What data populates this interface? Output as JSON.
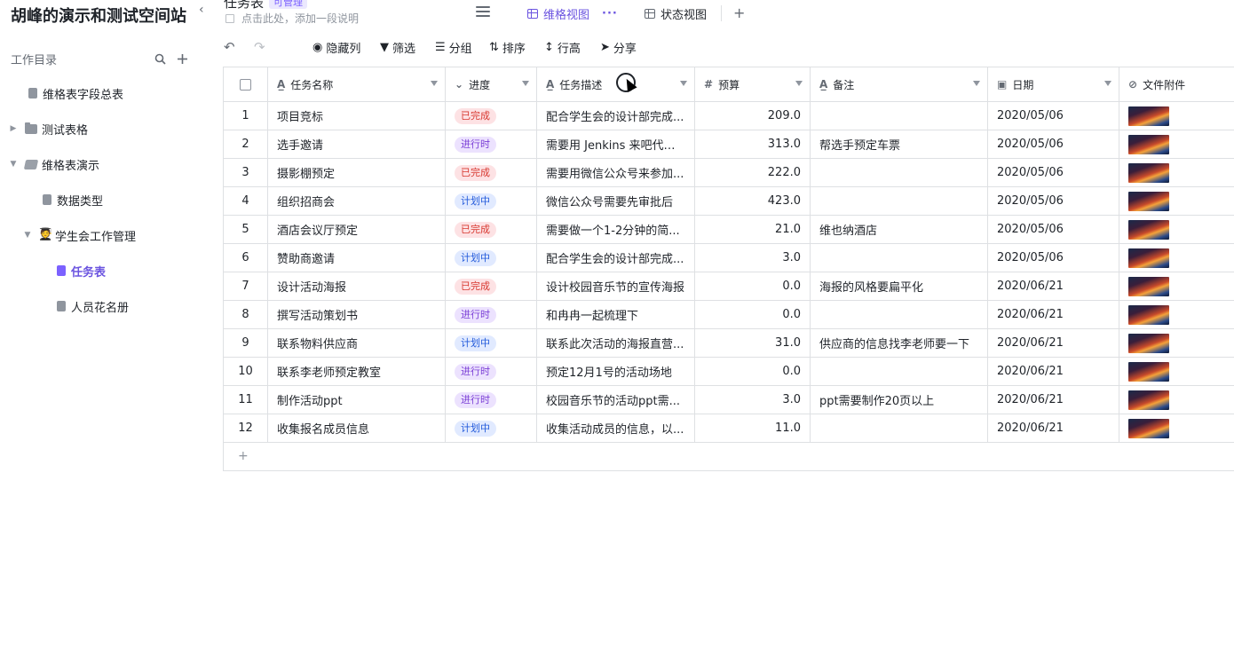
{
  "sidebar": {
    "space_title": "胡峰的演示和测试空间站",
    "workdir_label": "工作目录",
    "items": [
      {
        "label": "维格表字段总表"
      },
      {
        "label": "测试表格"
      },
      {
        "label": "维格表演示"
      },
      {
        "label": "数据类型"
      },
      {
        "label": "学生会工作管理"
      },
      {
        "label": "任务表"
      },
      {
        "label": "人员花名册"
      }
    ]
  },
  "header": {
    "title": "任务表",
    "permission": "可管理",
    "description_placeholder": "点击此处，添加一段说明",
    "tabs": [
      {
        "label": "维格视图"
      },
      {
        "label": "状态视图"
      }
    ],
    "tab_more": "···"
  },
  "toolbar": {
    "hide_columns": "隐藏列",
    "filter": "筛选",
    "group": "分组",
    "sort": "排序",
    "row_height": "行高",
    "share": "分享"
  },
  "table": {
    "columns": [
      "任务名称",
      "进度",
      "任务描述",
      "预算",
      "备注",
      "日期",
      "文件附件"
    ],
    "rows": [
      {
        "num": "1",
        "name": "项目竞标",
        "status": "已完成",
        "desc": "配合学生会的设计部完成...",
        "budget": "209.0",
        "note": "",
        "date": "2020/05/06"
      },
      {
        "num": "2",
        "name": "选手邀请",
        "status": "进行时",
        "desc": "需要用 Jenkins 来吧代码...",
        "budget": "313.0",
        "note": "帮选手预定车票",
        "date": "2020/05/06"
      },
      {
        "num": "3",
        "name": "摄影棚预定",
        "status": "已完成",
        "desc": "需要用微信公众号来参加...",
        "budget": "222.0",
        "note": "",
        "date": "2020/05/06"
      },
      {
        "num": "4",
        "name": "组织招商会",
        "status": "计划中",
        "desc": "微信公众号需要先审批后",
        "budget": "423.0",
        "note": "",
        "date": "2020/05/06"
      },
      {
        "num": "5",
        "name": "酒店会议厅预定",
        "status": "已完成",
        "desc": "需要做一个1-2分钟的简...",
        "budget": "21.0",
        "note": "维也纳酒店",
        "date": "2020/05/06"
      },
      {
        "num": "6",
        "name": "赞助商邀请",
        "status": "计划中",
        "desc": "配合学生会的设计部完成...",
        "budget": "3.0",
        "note": "",
        "date": "2020/05/06"
      },
      {
        "num": "7",
        "name": "设计活动海报",
        "status": "已完成",
        "desc": "设计校园音乐节的宣传海报",
        "budget": "0.0",
        "note": "海报的风格要扁平化",
        "date": "2020/06/21"
      },
      {
        "num": "8",
        "name": "撰写活动策划书",
        "status": "进行时",
        "desc": "和冉冉一起梳理下",
        "budget": "0.0",
        "note": "",
        "date": "2020/06/21"
      },
      {
        "num": "9",
        "name": "联系物料供应商",
        "status": "计划中",
        "desc": "联系此次活动的海报直营...",
        "budget": "31.0",
        "note": "供应商的信息找李老师要一下",
        "date": "2020/06/21"
      },
      {
        "num": "10",
        "name": "联系李老师预定教室",
        "status": "进行时",
        "desc": "预定12月1号的活动场地",
        "budget": "0.0",
        "note": "",
        "date": "2020/06/21"
      },
      {
        "num": "11",
        "name": "制作活动ppt",
        "status": "进行时",
        "desc": "校园音乐节的活动ppt需...",
        "budget": "3.0",
        "note": "ppt需要制作20页以上",
        "date": "2020/06/21"
      },
      {
        "num": "12",
        "name": "收集报名成员信息",
        "status": "计划中",
        "desc": "收集活动成员的信息，以...",
        "budget": "11.0",
        "note": "",
        "date": "2020/06/21"
      }
    ],
    "add_row": "+"
  },
  "status_colors": {
    "已完成": {
      "bg": "#fde2e4",
      "fg": "#d83931"
    },
    "进行时": {
      "bg": "#ece2fe",
      "fg": "#7b3fd6"
    },
    "计划中": {
      "bg": "#e1eaff",
      "fg": "#245bdb"
    }
  },
  "accent_color": "#6b54e0"
}
